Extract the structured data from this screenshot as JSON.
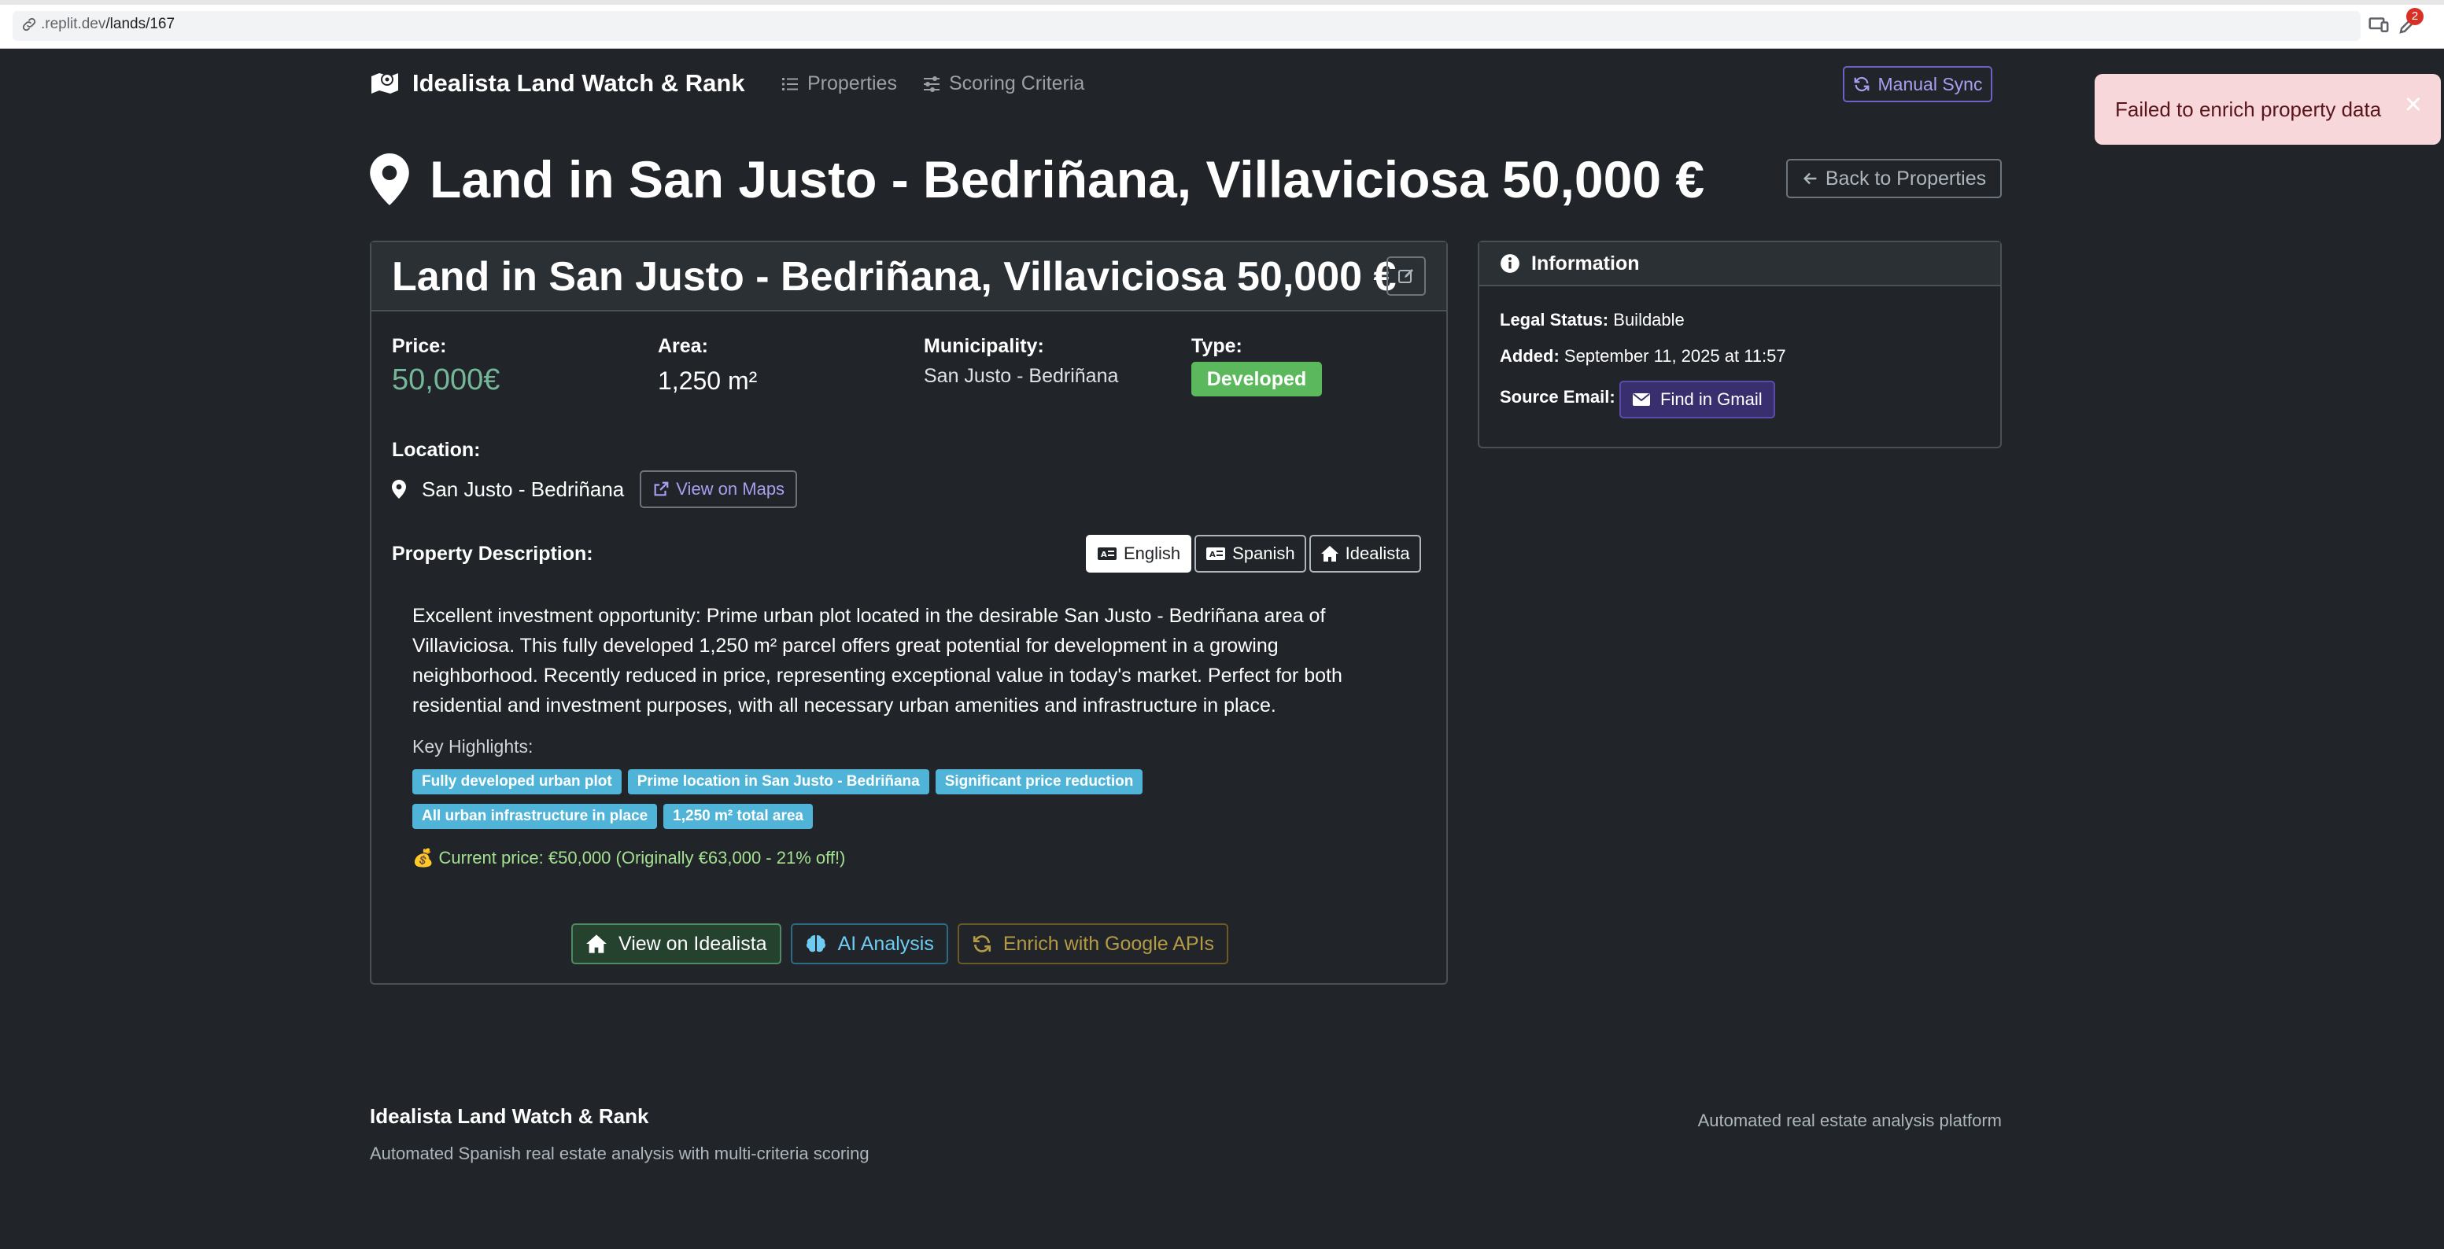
{
  "browser": {
    "url_prefix": ".replit.dev",
    "url_path": "/lands/167",
    "notification_count": "2"
  },
  "navbar": {
    "brand": "Idealista Land Watch & Rank",
    "links": [
      "Properties",
      "Scoring Criteria"
    ],
    "sync_label": "Manual Sync"
  },
  "toast": {
    "message": "Failed to enrich property data",
    "close": "×"
  },
  "page": {
    "title": "Land in San Justo - Bedriñana, Villaviciosa 50,000 €",
    "back_label": "Back to Properties"
  },
  "property": {
    "card_title": "Land in San Justo - Bedriñana, Villaviciosa 50,000 €",
    "price_label": "Price:",
    "price": "50,000€",
    "area_label": "Area:",
    "area": "1,250 m²",
    "municipality_label": "Municipality:",
    "municipality": "San Justo - Bedriñana",
    "type_label": "Type:",
    "type": "Developed",
    "location_label": "Location:",
    "location": "San Justo - Bedriñana",
    "maps_label": "View on Maps",
    "description_label": "Property Description:",
    "languages": [
      "English",
      "Spanish",
      "Idealista"
    ],
    "active_language": "English",
    "description": "Excellent investment opportunity: Prime urban plot located in the desirable San Justo - Bedriñana area of Villaviciosa. This fully developed 1,250 m² parcel offers great potential for development in a growing neighborhood. Recently reduced in price, representing exceptional value in today's market. Perfect for both residential and investment purposes, with all necessary urban amenities and infrastructure in place.",
    "highlights_label": "Key Highlights:",
    "highlights": [
      "Fully developed urban plot",
      "Prime location in San Justo - Bedriñana",
      "Significant price reduction",
      "All urban infrastructure in place",
      "1,250 m² total area"
    ],
    "price_note": "💰 Current price: €50,000 (Originally €63,000 - 21% off!)",
    "actions": {
      "idealista": "View on Idealista",
      "ai": "AI Analysis",
      "enrich": "Enrich with Google APIs"
    }
  },
  "info": {
    "header": "Information",
    "legal_label": "Legal Status:",
    "legal_value": "Buildable",
    "added_label": "Added:",
    "added_value": "September 11, 2025 at 11:57",
    "source_label": "Source Email:",
    "gmail_label": "Find in Gmail"
  },
  "footer": {
    "title": "Idealista Land Watch & Rank",
    "subtitle": "Automated Spanish real estate analysis with multi-criteria scoring",
    "right": "Automated real estate analysis platform"
  },
  "colors": {
    "background": "#212529",
    "price_green": "#75b798",
    "badge_green": "#5cb85c",
    "chip_cyan": "#4fb4d8",
    "accent_purple": "#a89ff0",
    "toast_bg": "#f8d7da"
  }
}
